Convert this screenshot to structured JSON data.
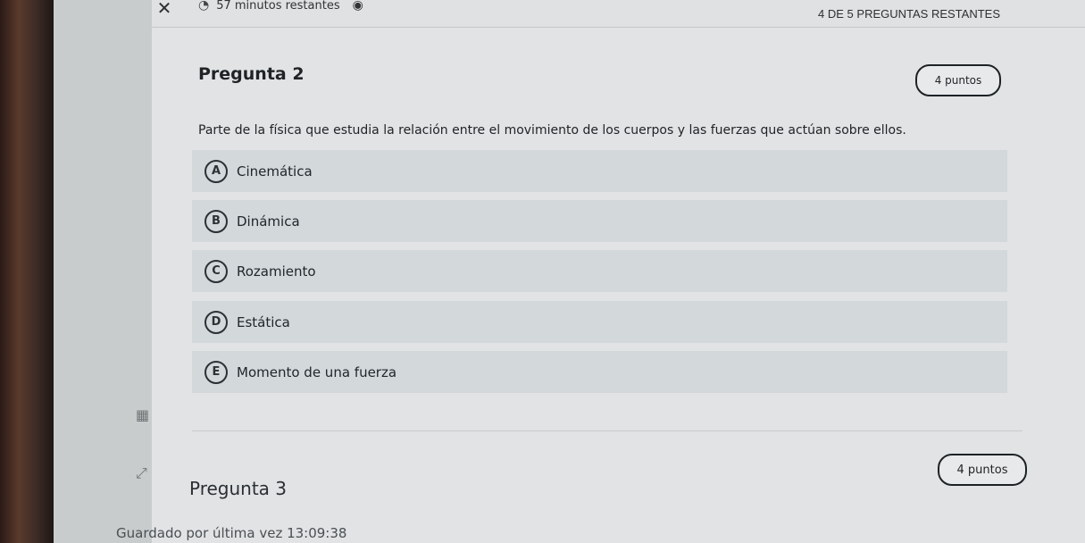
{
  "header": {
    "time_remaining": "57 minutos restantes",
    "questions_remaining": "4 DE 5 PREGUNTAS RESTANTES"
  },
  "question": {
    "title": "Pregunta 2",
    "points": "4 puntos",
    "text": "Parte de la física que estudia la relación entre el movimiento de los cuerpos y las fuerzas que actúan sobre ellos.",
    "options": [
      {
        "letter": "A",
        "text": "Cinemática"
      },
      {
        "letter": "B",
        "text": "Dinámica"
      },
      {
        "letter": "C",
        "text": "Rozamiento"
      },
      {
        "letter": "D",
        "text": "Estática"
      },
      {
        "letter": "E",
        "text": "Momento de una fuerza"
      }
    ]
  },
  "next_question": {
    "title": "Pregunta 3",
    "points": "4 puntos"
  },
  "footer": {
    "saved_text": "Guardado por última vez 13:09:38"
  },
  "icons": {
    "close": "close-icon",
    "timer": "timer-icon",
    "visibility": "eye-icon"
  }
}
